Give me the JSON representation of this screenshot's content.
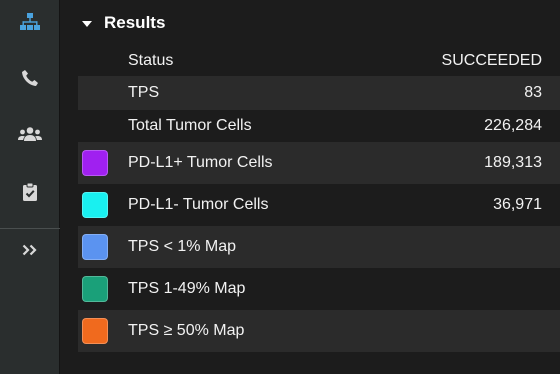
{
  "sidebar": {
    "icons": [
      {
        "name": "sitemap-icon",
        "color": "#4aa3df"
      },
      {
        "name": "phone-icon",
        "color": "#d8d8d8"
      },
      {
        "name": "users-icon",
        "color": "#d8d8d8"
      },
      {
        "name": "clipboard-check-icon",
        "color": "#d8d8d8"
      },
      {
        "name": "expand-chevrons-icon",
        "color": "#d8d8d8"
      }
    ]
  },
  "results": {
    "title": "Results",
    "rows": [
      {
        "label": "Status",
        "value": "SUCCEEDED",
        "swatch": null
      },
      {
        "label": "TPS",
        "value": "83",
        "swatch": null
      },
      {
        "label": "Total Tumor Cells",
        "value": "226,284",
        "swatch": null
      },
      {
        "label": "PD-L1+ Tumor Cells",
        "value": "189,313",
        "swatch": "#a020f0"
      },
      {
        "label": "PD-L1- Tumor Cells",
        "value": "36,971",
        "swatch": "#19f0f0"
      },
      {
        "label": "TPS < 1% Map",
        "value": "",
        "swatch": "#5b93f0"
      },
      {
        "label": "TPS 1-49% Map",
        "value": "",
        "swatch": "#1aa079"
      },
      {
        "label": "TPS ≥ 50% Map",
        "value": "",
        "swatch": "#f06a1e"
      }
    ]
  }
}
